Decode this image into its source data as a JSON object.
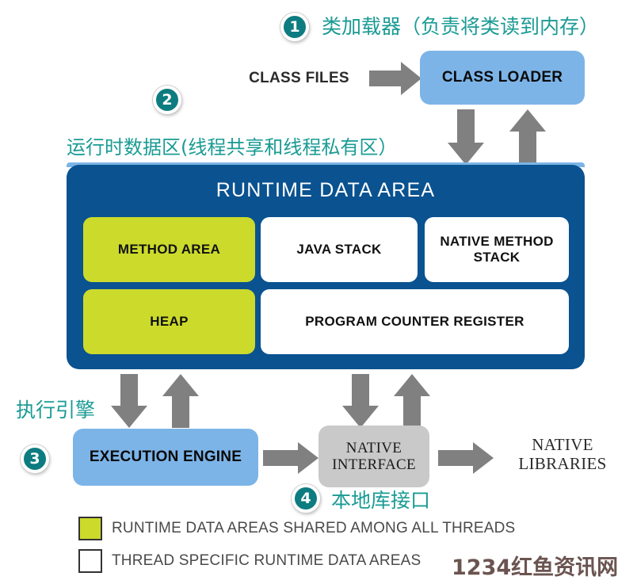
{
  "diagram": {
    "title_cn_1": "类加载器（负责将类读到内存）",
    "steps": {
      "one": "1",
      "two": "2",
      "three": "3",
      "four": "4"
    },
    "annotations": {
      "class_loader_cn": "类加载器（负责将类读到内存）",
      "runtime_data_area_cn": "运行时数据区(线程共享和线程私有区）",
      "execution_engine_cn": "执行引擎",
      "native_interface_cn": "本地库接口"
    },
    "class_files_label": "CLASS FILES",
    "class_loader_label": "CLASS LOADER",
    "runtime_data_area": {
      "title": "RUNTIME DATA AREA",
      "row1": [
        {
          "label": "METHOD AREA",
          "shared": true
        },
        {
          "label": "JAVA STACK",
          "shared": false
        },
        {
          "label": "NATIVE METHOD STACK",
          "shared": false
        }
      ],
      "row2": [
        {
          "label": "HEAP",
          "shared": true
        },
        {
          "label": "PROGRAM COUNTER REGISTER",
          "shared": false
        }
      ]
    },
    "execution_engine_label": "EXECUTION ENGINE",
    "native_interface_label": "NATIVE INTERFACE",
    "native_libraries_label": "NATIVE LIBRARIES",
    "legend": [
      {
        "swatch": "green",
        "text": "RUNTIME DATA AREAS SHARED AMONG ALL THREADS"
      },
      {
        "swatch": "white",
        "text": "THREAD SPECIFIC RUNTIME DATA AREAS"
      }
    ],
    "watermark": "1234红鱼资讯网",
    "colors": {
      "accent_teal": "#0d7c80",
      "annotation_teal": "#1a9b94",
      "box_blue": "#7cb4e8",
      "runtime_blue": "#0a5290",
      "shared_green": "#ccdb2b",
      "arrow_grey": "#808080",
      "native_grey": "#c9c9c9"
    }
  }
}
